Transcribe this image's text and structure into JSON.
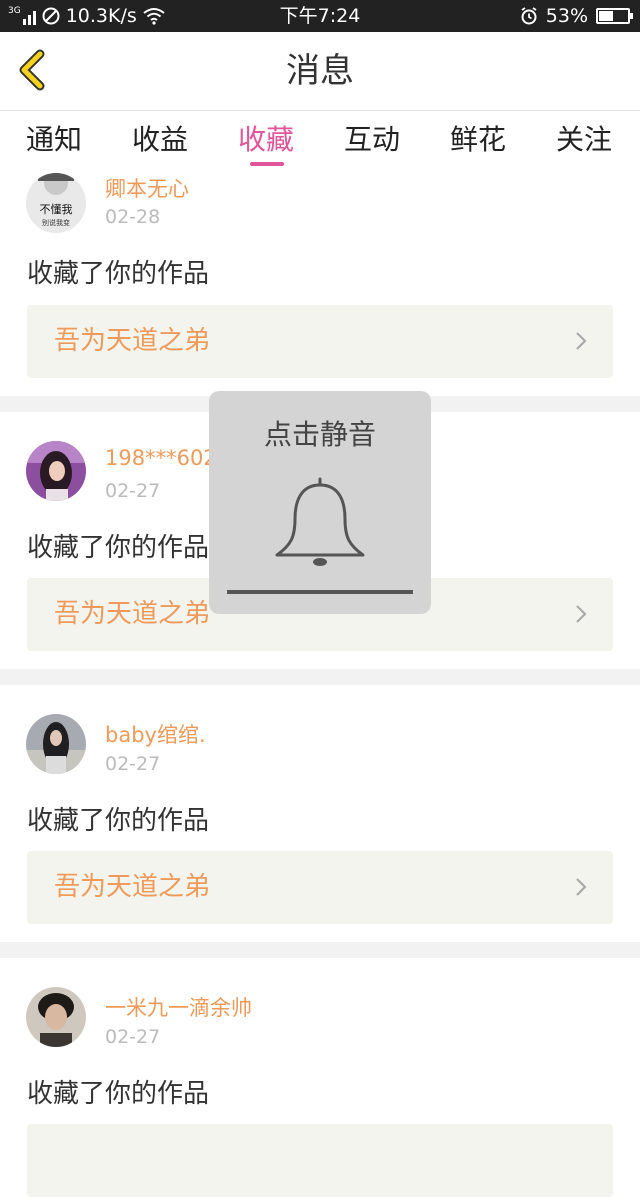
{
  "status_bar": {
    "network": "3G",
    "speed": "10.3K/s",
    "time": "下午7:24",
    "battery": "53%",
    "battery_level": 0.53
  },
  "header": {
    "title": "消息"
  },
  "tabs": [
    {
      "label": "通知",
      "active": false
    },
    {
      "label": "收益",
      "active": false
    },
    {
      "label": "收藏",
      "active": true
    },
    {
      "label": "互动",
      "active": false
    },
    {
      "label": "鲜花",
      "active": false
    },
    {
      "label": "关注",
      "active": false
    }
  ],
  "items": [
    {
      "username": "卿本无心",
      "date": "02-28",
      "action": "收藏了你的作品",
      "work": "吾为天道之弟",
      "avatar_text": "不懂我",
      "avatar_subtext": "别说我变"
    },
    {
      "username": "198***602",
      "date": "02-27",
      "action": "收藏了你的作品",
      "work": "吾为天道之弟"
    },
    {
      "username": "baby绾绾.",
      "date": "02-27",
      "action": "收藏了你的作品",
      "work": "吾为天道之弟"
    },
    {
      "username": "一米九一滴余帅",
      "date": "02-27",
      "action": "收藏了你的作品",
      "work": ""
    }
  ],
  "mute_overlay": {
    "label": "点击静音",
    "icon": "bell-icon"
  },
  "colors": {
    "accent_pink": "#e2559b",
    "accent_orange": "#ee9a5a"
  }
}
